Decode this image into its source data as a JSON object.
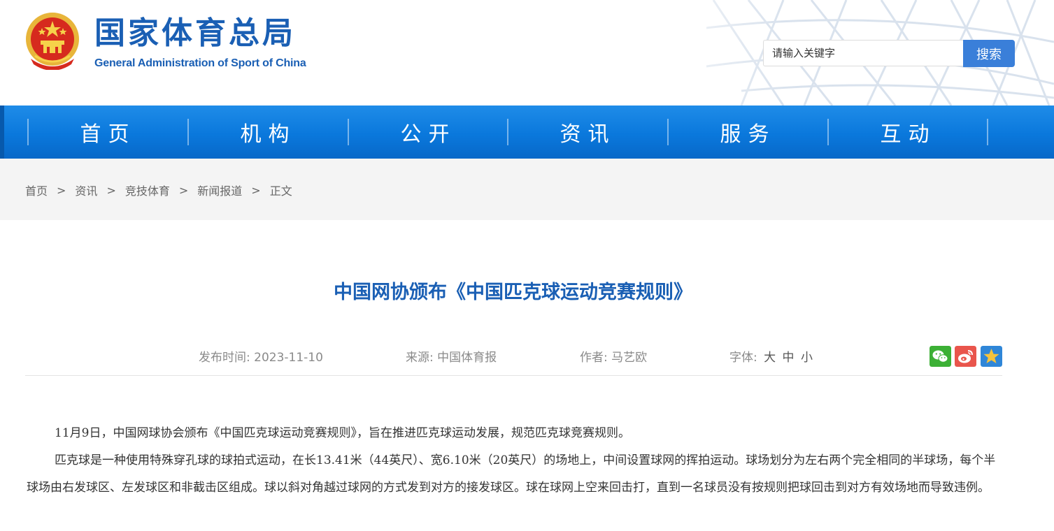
{
  "header": {
    "title_cn": "国家体育总局",
    "title_en": "General Administration of Sport of China",
    "emblem_icon": "national-emblem-icon",
    "brand_color": "#1a5fb4"
  },
  "search": {
    "placeholder": "请输入关键字",
    "button_label": "搜索",
    "button_color": "#3a7fd9"
  },
  "nav": {
    "color": "#0a78dc",
    "items": [
      {
        "label": "首页"
      },
      {
        "label": "机构"
      },
      {
        "label": "公开"
      },
      {
        "label": "资讯"
      },
      {
        "label": "服务"
      },
      {
        "label": "互动"
      }
    ]
  },
  "breadcrumb": {
    "items": [
      "首页",
      "资讯",
      "竞技体育",
      "新闻报道",
      "正文"
    ],
    "separator": ">"
  },
  "article": {
    "title": "中国网协颁布《中国匹克球运动竞赛规则》",
    "meta": {
      "date_label": "发布时间:",
      "date": "2023-11-10",
      "source_label": "来源:",
      "source": "中国体育报",
      "author_label": "作者:",
      "author": "马艺欧",
      "font_label": "字体:",
      "font_large": "大",
      "font_medium": "中",
      "font_small": "小"
    },
    "share_icons": [
      "wechat-icon",
      "weibo-icon",
      "favorite-star-icon"
    ],
    "paragraphs": [
      "11月9日，中国网球协会颁布《中国匹克球运动竞赛规则》，旨在推进匹克球运动发展，规范匹克球竞赛规则。",
      "匹克球是一种使用特殊穿孔球的球拍式运动，在长13.41米（44英尺）、宽6.10米（20英尺）的场地上，中间设置球网的挥拍运动。球场划分为左右两个完全相同的半球场，每个半球场由右发球区、左发球区和非截击区组成。球以斜对角越过球网的方式发到对方的接发球区。球在球网上空来回击打，直到一名球员没有按规则把球回击到对方有效场地而导致违例。"
    ]
  }
}
